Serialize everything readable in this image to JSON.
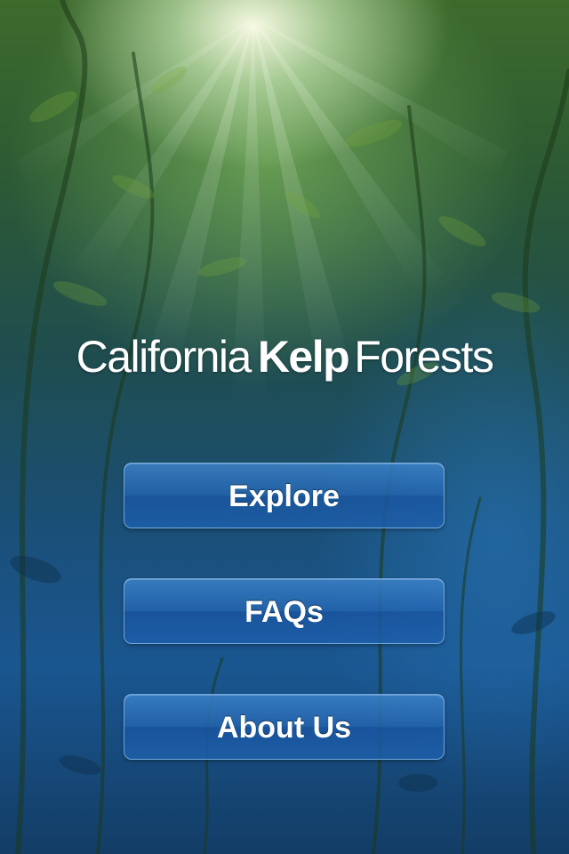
{
  "app": {
    "title_prefix": "California",
    "title_bold": "Kelp",
    "title_suffix": "Forests"
  },
  "menu": {
    "explore_label": "Explore",
    "faqs_label": "FAQs",
    "about_label": "About Us"
  },
  "colors": {
    "button_fill": "#2a6cb4",
    "button_border": "#8cbeeb",
    "text": "#ffffff"
  }
}
